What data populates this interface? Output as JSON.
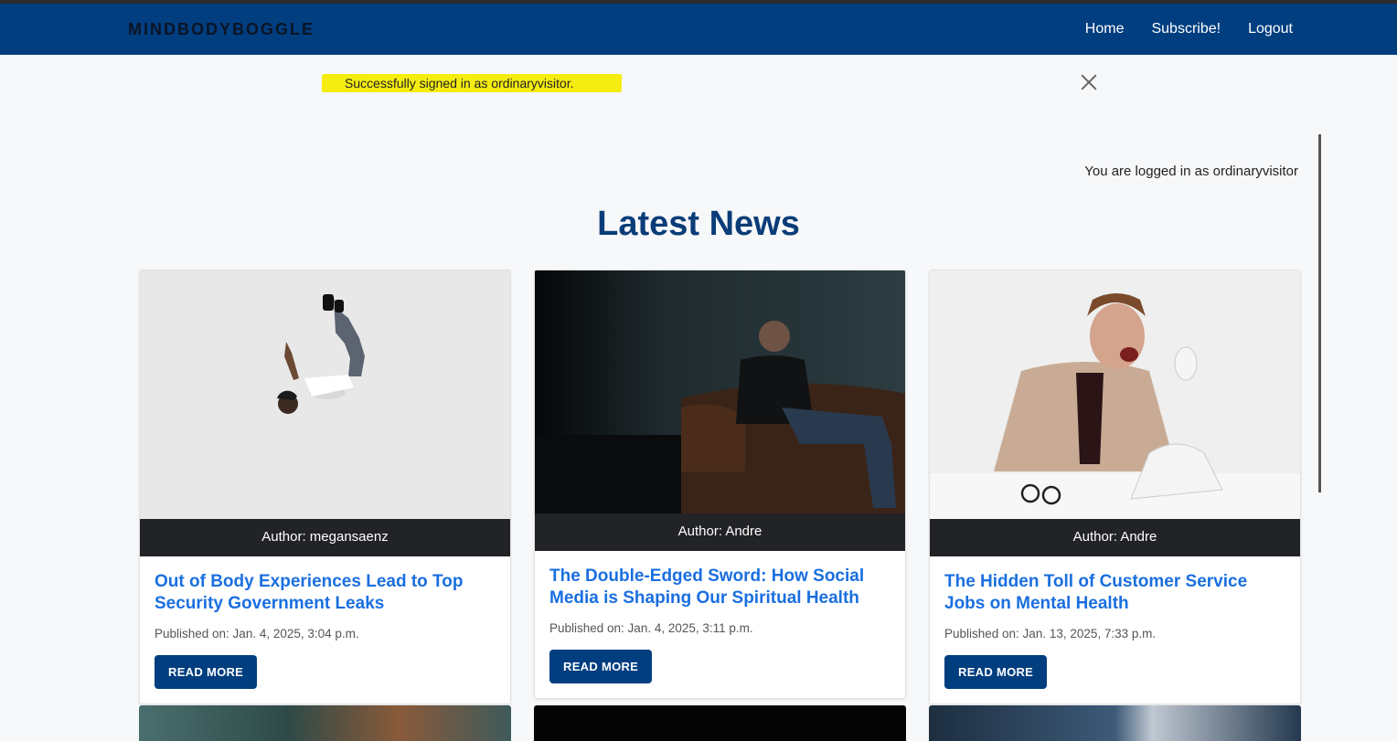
{
  "nav": {
    "brand": "MINDBODYBOGGLE",
    "links": [
      "Home",
      "Subscribe!",
      "Logout"
    ]
  },
  "alert": {
    "message": "Successfully signed in as ordinaryvisitor."
  },
  "status": {
    "logged_in": "You are logged in as ordinaryvisitor"
  },
  "page": {
    "title": "Latest News"
  },
  "articles": [
    {
      "author": "Author: megansaenz",
      "title": "Out of Body Experiences Lead to Top Security Government Leaks",
      "date": "Published on: Jan. 4, 2025, 3:04 p.m.",
      "button": "READ MORE"
    },
    {
      "author": "Author: Andre",
      "title": "The Double-Edged Sword: How Social Media is Shaping Our Spiritual Health",
      "date": "Published on: Jan. 4, 2025, 3:11 p.m.",
      "button": "READ MORE"
    },
    {
      "author": "Author: Andre",
      "title": "The Hidden Toll of Customer Service Jobs on Mental Health",
      "date": "Published on: Jan. 13, 2025, 7:33 p.m.",
      "button": "READ MORE"
    }
  ],
  "colors": {
    "navbar": "#003e80",
    "accent_link": "#1a6fe0",
    "title": "#0a3d78",
    "highlight": "#f5ec10"
  }
}
